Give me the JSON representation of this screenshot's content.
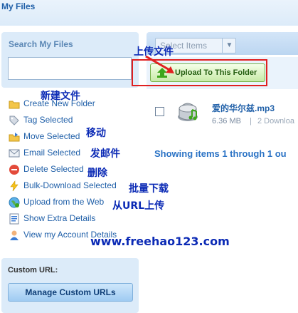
{
  "header": {
    "title": "My Files"
  },
  "search": {
    "label": "Search My Files",
    "value": ""
  },
  "toolbar": {
    "select_placeholder": "Select Items",
    "upload_label": "Upload To This Folder"
  },
  "actions": [
    {
      "label": "Create New Folder",
      "icon": "folder-icon"
    },
    {
      "label": "Tag Selected",
      "icon": "tag-icon"
    },
    {
      "label": "Move Selected",
      "icon": "move-icon"
    },
    {
      "label": "Email Selected",
      "icon": "email-icon"
    },
    {
      "label": "Delete Selected",
      "icon": "delete-icon"
    },
    {
      "label": "Bulk-Download Selected",
      "icon": "lightning-icon"
    },
    {
      "label": "Upload from the Web",
      "icon": "globe-icon"
    },
    {
      "label": "Show Extra Details",
      "icon": "details-icon"
    },
    {
      "label": "View my Account Details",
      "icon": "user-icon"
    }
  ],
  "file": {
    "name": "爱的华尔兹.mp3",
    "size": "6.36 MB",
    "separator": "|",
    "downloads": "2 Downloa"
  },
  "listing": {
    "showing_text": "Showing items 1 through 1 ou"
  },
  "custom_url": {
    "label": "Custom URL:",
    "button_label": "Manage Custom URLs"
  },
  "annotations": {
    "upload_file": "上传文件",
    "new_folder": "新建文件",
    "move": "移动",
    "send_email": "发邮件",
    "delete": "删除",
    "bulk_download": "批量下载",
    "upload_url": "从URL上传",
    "watermark": "www.freehao123.com"
  },
  "colors": {
    "link": "#1f5fa8",
    "highlight": "#e02020",
    "annotation": "#0b2ab5",
    "upload_green": "#3ea61b"
  }
}
